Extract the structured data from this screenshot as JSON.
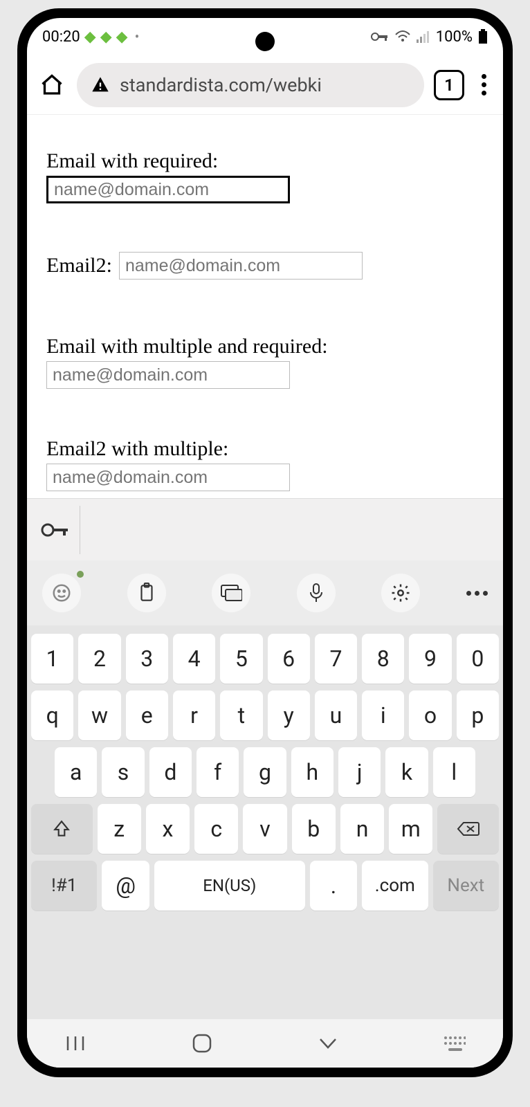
{
  "statusbar": {
    "time": "00:20",
    "battery_text": "100%"
  },
  "browser": {
    "url": "standardista.com/webki",
    "tab_count": "1"
  },
  "form": {
    "field1_label": "Email with required:",
    "field1_placeholder": "name@domain.com",
    "field2_label": "Email2:",
    "field2_placeholder": "name@domain.com",
    "field3_label": "Email with multiple and required:",
    "field3_placeholder": "name@domain.com",
    "field4_label": "Email2 with multiple:",
    "field4_placeholder": "name@domain.com"
  },
  "keyboard": {
    "row1": [
      "1",
      "2",
      "3",
      "4",
      "5",
      "6",
      "7",
      "8",
      "9",
      "0"
    ],
    "row2": [
      "q",
      "w",
      "e",
      "r",
      "t",
      "y",
      "u",
      "i",
      "o",
      "p"
    ],
    "row3": [
      "a",
      "s",
      "d",
      "f",
      "g",
      "h",
      "j",
      "k",
      "l"
    ],
    "row4": [
      "z",
      "x",
      "c",
      "v",
      "b",
      "n",
      "m"
    ],
    "symkey": "!#1",
    "atkey": "@",
    "spacekey": "EN(US)",
    "dotkey": ".",
    "comkey": ".com",
    "nextkey": "Next"
  }
}
